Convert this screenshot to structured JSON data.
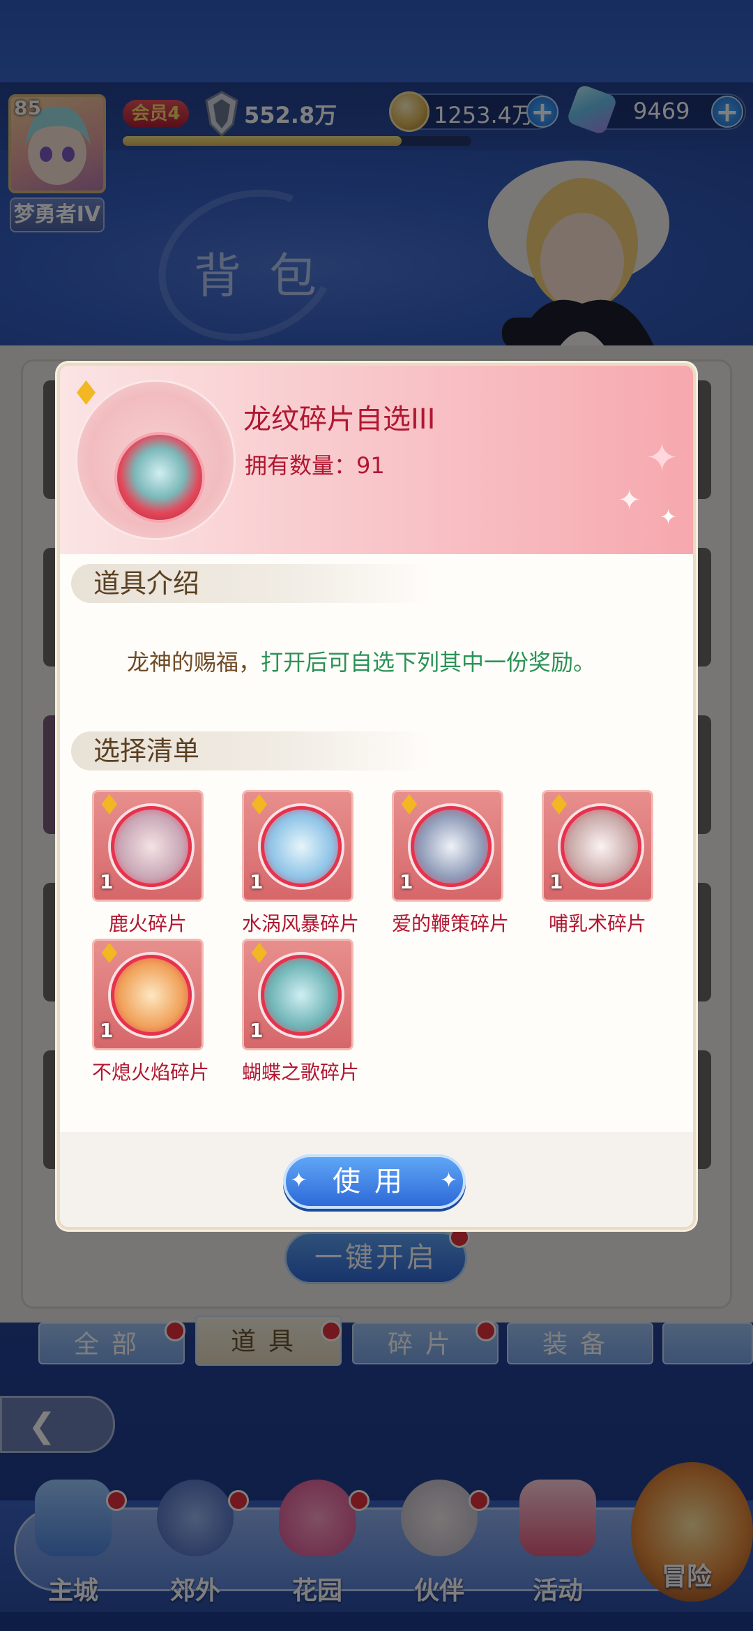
{
  "hud": {
    "level": "85",
    "rank_title": "梦勇者IV",
    "vip": "会员4",
    "power": "552.8万",
    "gold": "1253.4万",
    "gems": "9469",
    "xp_fraction": 0.8
  },
  "page_title": "背包",
  "modal": {
    "item_name": "龙纹碎片自选III",
    "owned_label": "拥有数量：91",
    "intro_section": "道具介绍",
    "intro_text_a": "龙神的赐福，",
    "intro_text_b": "打开后可自选下列其中一份奖励。",
    "list_section": "选择清单",
    "rewards": [
      {
        "name": "鹿火碎片",
        "count": "1"
      },
      {
        "name": "水涡风暴碎片",
        "count": "1"
      },
      {
        "name": "爱的鞭策碎片",
        "count": "1"
      },
      {
        "name": "哺乳术碎片",
        "count": "1"
      },
      {
        "name": "不熄火焰碎片",
        "count": "1"
      },
      {
        "name": "蝴蝶之歌碎片",
        "count": "1"
      }
    ],
    "use_button": "使用"
  },
  "open_all_button": "一键开启",
  "category_tabs": [
    "全部",
    "道具",
    "碎片",
    "装备"
  ],
  "nav": [
    "主城",
    "郊外",
    "花园",
    "伙伴",
    "活动",
    "冒险"
  ],
  "colors": {
    "accent_red": "#b01731",
    "intro_green": "#2a9256",
    "button_blue": "#2d69d8"
  }
}
